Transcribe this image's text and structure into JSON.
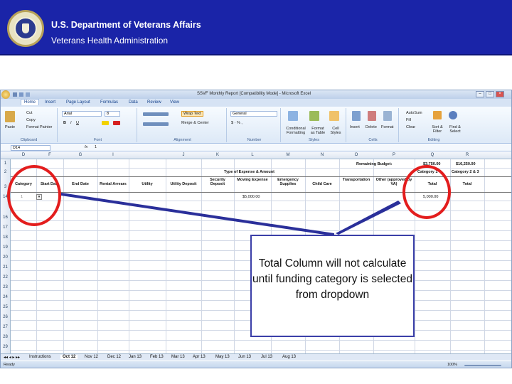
{
  "header": {
    "department": "U.S. Department of Veterans Affairs",
    "administration": "Veterans Health Administration"
  },
  "excel": {
    "window_title": "SSVF Monthly Report  [Compatibility Mode]  -  Microsoft Excel",
    "ribbon_tabs": [
      "Home",
      "Insert",
      "Page Layout",
      "Formulas",
      "Data",
      "Review",
      "View"
    ],
    "active_tab": "Home",
    "clipboard": {
      "paste": "Paste",
      "cut": "Cut",
      "copy": "Copy",
      "format_painter": "Format Painter",
      "group": "Clipboard"
    },
    "font": {
      "name": "Arial",
      "size": "8",
      "group": "Font"
    },
    "alignment": {
      "wrap_text": "Wrap Text",
      "merge": "Merge & Center",
      "group": "Alignment"
    },
    "number": {
      "format": "General",
      "group": "Number"
    },
    "styles": {
      "conditional": "Conditional Formatting",
      "format_table": "Format as Table",
      "cell_styles": "Cell Styles",
      "group": "Styles"
    },
    "cells": {
      "insert": "Insert",
      "delete": "Delete",
      "format": "Format",
      "group": "Cells"
    },
    "editing": {
      "autosum": "AutoSum",
      "fill": "Fill",
      "clear": "Clear",
      "sort": "Sort & Filter",
      "find": "Find & Select",
      "group": "Editing"
    },
    "name_box": "D14",
    "formula_value": "1",
    "columns": [
      "D",
      "F",
      "G",
      "I",
      "J",
      "K",
      "L",
      "M",
      "N",
      "O",
      "P",
      "Q",
      "R"
    ],
    "rows": [
      "1",
      "2",
      "3",
      "14",
      "16",
      "17",
      "18",
      "19",
      "20",
      "21",
      "22",
      "23",
      "24",
      "25",
      "26",
      "27",
      "28",
      "29",
      "30"
    ],
    "remaining_budget_label": "Remaining Budget:",
    "remaining_budget_q": "$3,750.00",
    "remaining_budget_r": "$16,250.00",
    "type_of_expense_header": "Type of Expense & Amount",
    "category_1_label": "Category 1",
    "category_2_label": "Category 2 & 3",
    "headers": {
      "category": "Category",
      "start_date": "Start Date",
      "end_date": "End Date",
      "rental_arrears": "Rental Arrears",
      "utility": "Utility",
      "utility_deposit": "Utility Deposit",
      "security_deposit": "Security Deposit",
      "moving_expense": "Moving Expense",
      "emergency_supplies": "Emergency Supplies",
      "child_care": "Child Care",
      "transportation": "Transportation",
      "other_approved": "Other (approved by VA)",
      "total_q": "Total",
      "total_r": "Total"
    },
    "data_row": {
      "category_value": "1",
      "moving_expense": "$5,000.00",
      "total": "5,000.00"
    },
    "sheet_tabs": [
      "Instructions",
      "Oct 12",
      "Nov 12",
      "Dec 12",
      "Jan 13",
      "Feb 13",
      "Mar 13",
      "Apr 13",
      "May 13",
      "Jun 13",
      "Jul 13",
      "Aug 13"
    ],
    "active_sheet": "Oct 12",
    "status": "Ready",
    "zoom": "100%"
  },
  "callout": {
    "text": "Total Column will not calculate until funding category is selected from dropdown",
    "circle_color": "#e31d1d",
    "pointer_color": "#2a2f9a"
  }
}
